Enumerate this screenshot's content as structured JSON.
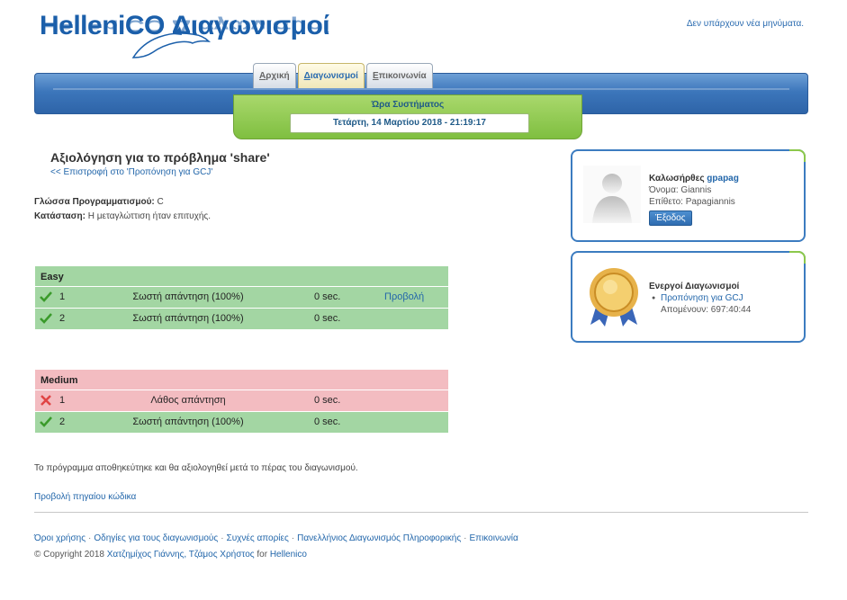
{
  "header": {
    "logo_text": "HelleniCO Διαγωνισμοί",
    "no_messages": "Δεν υπάρχουν νέα μηνύματα."
  },
  "nav": {
    "tabs": [
      {
        "first": "Α",
        "rest": "ρχική",
        "active": false
      },
      {
        "first": "Δ",
        "rest": "ιαγωνισμοί",
        "active": true
      },
      {
        "first": "Ε",
        "rest": "πικοινωνία",
        "active": false
      }
    ],
    "clock_title": "Ώρα Συστήματος",
    "clock_value": "Τετάρτη, 14 Μαρτίου 2018 - 21:19:17"
  },
  "main": {
    "title": "Αξιολόγηση για το πρόβλημα 'share'",
    "back_link": "<< Επιστροφή στο 'Προπόνηση για GCJ'",
    "language_label": "Γλώσσα Προγραμματισμού:",
    "language_value": "C",
    "status_label": "Κατάσταση:",
    "status_value": "Η μεταγλώττιση ήταν επιτυχής.",
    "groups": [
      {
        "name": "Easy",
        "color": "#a3d6a3",
        "rows": [
          {
            "num": "1",
            "result": "Σωστή απάντηση (100%)",
            "time": "0 sec.",
            "view": "Προβολή",
            "ok": true
          },
          {
            "num": "2",
            "result": "Σωστή απάντηση (100%)",
            "time": "0 sec.",
            "view": "",
            "ok": true
          }
        ]
      },
      {
        "name": "Medium",
        "color": "#f3bcc1",
        "rows": [
          {
            "num": "1",
            "result": "Λάθος απάντηση",
            "time": "0 sec.",
            "view": "",
            "ok": false
          },
          {
            "num": "2",
            "result": "Σωστή απάντηση (100%)",
            "time": "0 sec.",
            "view": "",
            "ok": true
          }
        ]
      }
    ],
    "note": "Το πρόγραμμα αποθηκεύτηκε και θα αξιολογηθεί μετά το πέρας του διαγωνισμού.",
    "source_link": "Προβολή πηγαίου κώδικα"
  },
  "sidebar": {
    "welcome": "Καλωσήρθες",
    "username": "gpapag",
    "first_name_label": "Όνομα:",
    "first_name": "Giannis",
    "last_name_label": "Επίθετο:",
    "last_name": "Papagiannis",
    "logout": "Έξοδος",
    "active_contests_title": "Ενεργοί Διαγωνισμοί",
    "contest_name": "Προπόνηση για GCJ",
    "remaining": "Απομένουν: 697:40:44"
  },
  "footer": {
    "links": [
      "Όροι χρήσης",
      "Οδηγίες για τους διαγωνισμούς",
      "Συχνές απορίες",
      "Πανελλήνιος Διαγωνισμός Πληροφορικής",
      "Επικοινωνία"
    ],
    "separator": "·",
    "copyright_prefix": "© Copyright 2018",
    "authors": "Χατζημίχος Γιάννης, Τζάμος Χρήστος",
    "for_text": "for",
    "org": "Hellenico"
  },
  "colors": {
    "accent_blue": "#3c76bb",
    "green_row": "#a3d6a3",
    "red_row": "#f3bcc1",
    "clock_green": "#7fbf40"
  }
}
